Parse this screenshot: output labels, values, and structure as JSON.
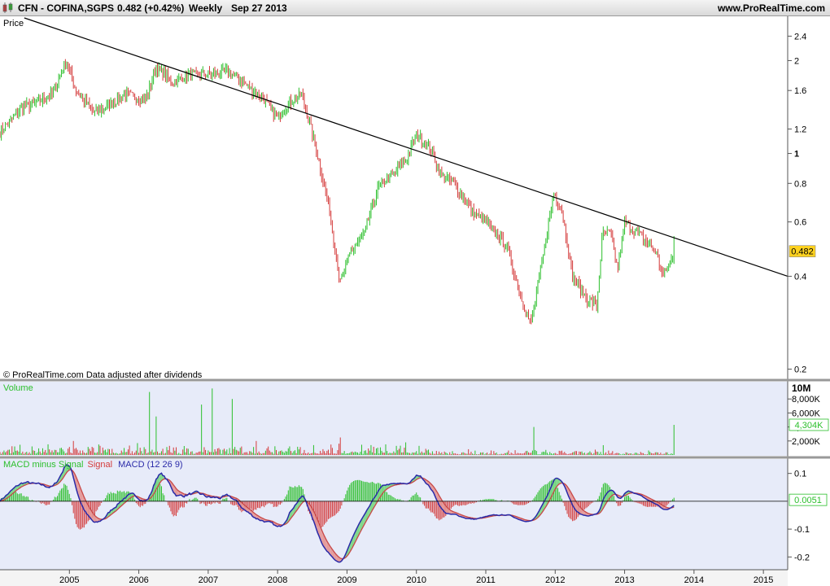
{
  "header": {
    "symbol": "CFN - COFINA,SGPS",
    "last": "0.482 (+0.42%)",
    "period": "Weekly",
    "date": "Sep 27 2013",
    "site": "www.ProRealTime.com"
  },
  "price_panel": {
    "label": "Price",
    "footer": "© ProRealTime.com  Data adjusted after dividends",
    "last_price_label": "0.482"
  },
  "volume_panel": {
    "label": "Volume",
    "unit_label": "10M",
    "last_value_label": "4,304K"
  },
  "macd_panel": {
    "label_hist": "MACD minus Signal",
    "label_signal": "Signal",
    "label_macd": "MACD (12 26 9)",
    "last_value_label": "0.0051"
  },
  "colors": {
    "up": "#2bbf2b",
    "down": "#d43a3a",
    "panel_bg": "#e7ebf9",
    "price_bg": "#ffffff",
    "trendline": "#000000",
    "macd_line": "#2a2aa8",
    "signal_line": "#c84848",
    "last_label_bg": "#ffd21f"
  },
  "chart_data": [
    {
      "type": "candlestick",
      "title": "CFN - COFINA,SGPS",
      "ylabel": "Price",
      "yscale": "log",
      "ylim": [
        0.19,
        2.75
      ],
      "xlim": [
        2004.0,
        2015.35
      ],
      "x_ticks": [
        2005,
        2006,
        2007,
        2008,
        2009,
        2010,
        2011,
        2012,
        2013,
        2014,
        2015
      ],
      "y_ticks": [
        0.2,
        0.4,
        0.6,
        0.8,
        1,
        1.2,
        1.6,
        2,
        2.4
      ],
      "last_price": 0.482,
      "trendline": [
        [
          2004.35,
          2.75
        ],
        [
          2015.35,
          0.4
        ]
      ],
      "keypoints": [
        [
          2004.0,
          1.17
        ],
        [
          2004.3,
          1.4
        ],
        [
          2004.5,
          1.45
        ],
        [
          2004.75,
          1.55
        ],
        [
          2004.95,
          2.0
        ],
        [
          2005.1,
          1.6
        ],
        [
          2005.35,
          1.35
        ],
        [
          2005.6,
          1.45
        ],
        [
          2005.8,
          1.55
        ],
        [
          2006.1,
          1.5
        ],
        [
          2006.25,
          1.9
        ],
        [
          2006.5,
          1.7
        ],
        [
          2006.7,
          1.8
        ],
        [
          2007.0,
          1.8
        ],
        [
          2007.3,
          1.85
        ],
        [
          2007.5,
          1.7
        ],
        [
          2007.8,
          1.5
        ],
        [
          2008.0,
          1.3
        ],
        [
          2008.15,
          1.45
        ],
        [
          2008.35,
          1.55
        ],
        [
          2008.55,
          1.05
        ],
        [
          2008.75,
          0.65
        ],
        [
          2008.9,
          0.38
        ],
        [
          2009.05,
          0.48
        ],
        [
          2009.25,
          0.55
        ],
        [
          2009.45,
          0.78
        ],
        [
          2009.65,
          0.85
        ],
        [
          2009.85,
          0.95
        ],
        [
          2010.0,
          1.15
        ],
        [
          2010.2,
          1.05
        ],
        [
          2010.35,
          0.85
        ],
        [
          2010.55,
          0.8
        ],
        [
          2010.8,
          0.65
        ],
        [
          2011.0,
          0.6
        ],
        [
          2011.3,
          0.5
        ],
        [
          2011.55,
          0.32
        ],
        [
          2011.65,
          0.28
        ],
        [
          2011.85,
          0.5
        ],
        [
          2011.98,
          0.75
        ],
        [
          2012.1,
          0.65
        ],
        [
          2012.25,
          0.4
        ],
        [
          2012.45,
          0.34
        ],
        [
          2012.6,
          0.32
        ],
        [
          2012.68,
          0.55
        ],
        [
          2012.8,
          0.55
        ],
        [
          2012.9,
          0.42
        ],
        [
          2013.0,
          0.6
        ],
        [
          2013.2,
          0.55
        ],
        [
          2013.45,
          0.48
        ],
        [
          2013.55,
          0.4
        ],
        [
          2013.65,
          0.44
        ],
        [
          2013.72,
          0.48
        ]
      ]
    },
    {
      "type": "bar",
      "title": "Volume",
      "ylim": [
        0,
        10000000
      ],
      "y_ticks": [
        2000000,
        4000000,
        6000000,
        8000000
      ],
      "y_tick_labels": [
        "2,000K",
        "4,000K",
        "6,000K",
        "8,000K"
      ],
      "last_value": 4304000,
      "spikes": [
        [
          2005.05,
          2000000
        ],
        [
          2006.15,
          9000000
        ],
        [
          2006.25,
          5500000
        ],
        [
          2006.9,
          7200000
        ],
        [
          2007.05,
          9500000
        ],
        [
          2007.35,
          8000000
        ],
        [
          2007.7,
          2000000
        ],
        [
          2008.9,
          2500000
        ],
        [
          2009.85,
          1800000
        ],
        [
          2011.7,
          4000000
        ],
        [
          2012.7,
          1400000
        ],
        [
          2013.72,
          4304000
        ]
      ]
    },
    {
      "type": "line",
      "title": "MACD (12 26 9)",
      "ylim": [
        -0.24,
        0.14
      ],
      "y_ticks": [
        0.1,
        -0.1,
        -0.2
      ],
      "y_tick_labels": [
        "0.1",
        "-0.1",
        "-0.2"
      ],
      "last_value": 0.0051,
      "series": [
        {
          "name": "MACD minus Signal"
        },
        {
          "name": "Signal"
        },
        {
          "name": "MACD (12 26 9)"
        }
      ]
    }
  ]
}
